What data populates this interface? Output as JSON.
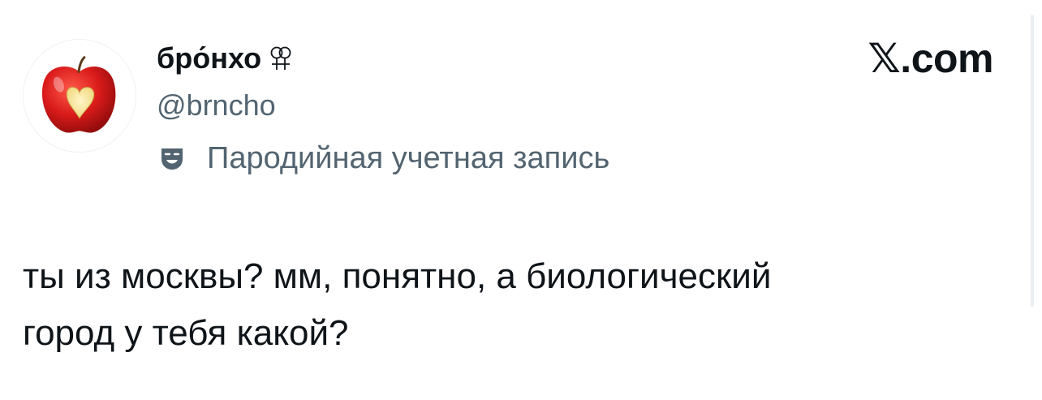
{
  "author": {
    "display_name": "бро́нхо",
    "handle": "@brncho",
    "avatar_icon": "apple-heart-icon",
    "name_emoji_icon": "double-female-sign-icon",
    "parody_icon": "theater-mask-icon",
    "parody_label": "Пародийная учетная запись"
  },
  "site": {
    "logo_text": "𝕏.com"
  },
  "tweet": {
    "lines": [
      "ты из москвы? мм, понятно, а биологический",
      "город у тебя какой?"
    ]
  },
  "colors": {
    "text_primary": "#0f1419",
    "text_secondary": "#536471",
    "background": "#ffffff",
    "apple_red": "#d91a1a"
  }
}
